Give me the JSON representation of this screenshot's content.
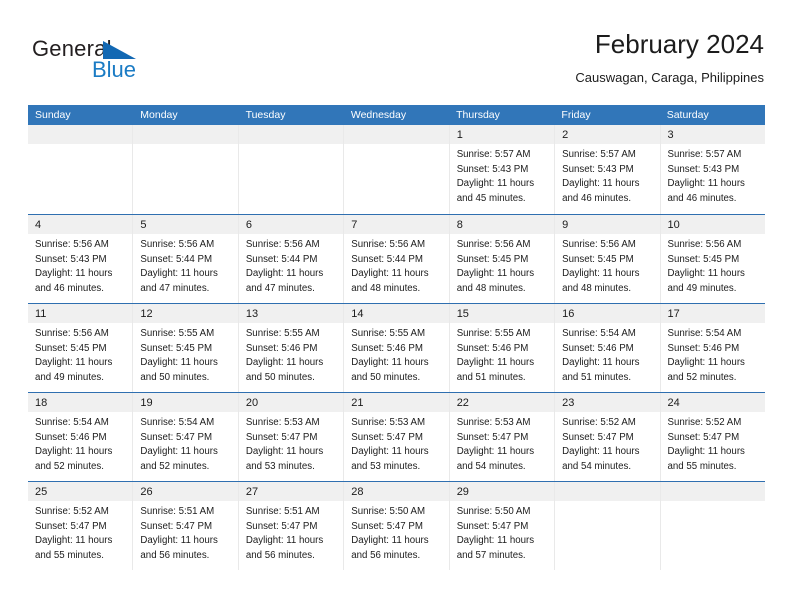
{
  "brand": {
    "name_top": "General",
    "name_bottom": "Blue"
  },
  "header": {
    "title": "February 2024",
    "subtitle": "Causwagan, Caraga, Philippines"
  },
  "colors": {
    "header_blue": "#3176b9",
    "row_divider_blue": "#2f6fb0",
    "day_head_gray": "#f0f0f0",
    "logo_blue": "#1a7bc4",
    "text": "#1c1c1c"
  },
  "weekdays": [
    "Sunday",
    "Monday",
    "Tuesday",
    "Wednesday",
    "Thursday",
    "Friday",
    "Saturday"
  ],
  "weeks": [
    [
      {
        "day": "",
        "empty": true,
        "lines": []
      },
      {
        "day": "",
        "empty": true,
        "lines": []
      },
      {
        "day": "",
        "empty": true,
        "lines": []
      },
      {
        "day": "",
        "empty": true,
        "lines": []
      },
      {
        "day": "1",
        "empty": false,
        "lines": [
          "Sunrise: 5:57 AM",
          "Sunset: 5:43 PM",
          "Daylight: 11 hours",
          "and 45 minutes."
        ]
      },
      {
        "day": "2",
        "empty": false,
        "lines": [
          "Sunrise: 5:57 AM",
          "Sunset: 5:43 PM",
          "Daylight: 11 hours",
          "and 46 minutes."
        ]
      },
      {
        "day": "3",
        "empty": false,
        "lines": [
          "Sunrise: 5:57 AM",
          "Sunset: 5:43 PM",
          "Daylight: 11 hours",
          "and 46 minutes."
        ]
      }
    ],
    [
      {
        "day": "4",
        "empty": false,
        "lines": [
          "Sunrise: 5:56 AM",
          "Sunset: 5:43 PM",
          "Daylight: 11 hours",
          "and 46 minutes."
        ]
      },
      {
        "day": "5",
        "empty": false,
        "lines": [
          "Sunrise: 5:56 AM",
          "Sunset: 5:44 PM",
          "Daylight: 11 hours",
          "and 47 minutes."
        ]
      },
      {
        "day": "6",
        "empty": false,
        "lines": [
          "Sunrise: 5:56 AM",
          "Sunset: 5:44 PM",
          "Daylight: 11 hours",
          "and 47 minutes."
        ]
      },
      {
        "day": "7",
        "empty": false,
        "lines": [
          "Sunrise: 5:56 AM",
          "Sunset: 5:44 PM",
          "Daylight: 11 hours",
          "and 48 minutes."
        ]
      },
      {
        "day": "8",
        "empty": false,
        "lines": [
          "Sunrise: 5:56 AM",
          "Sunset: 5:45 PM",
          "Daylight: 11 hours",
          "and 48 minutes."
        ]
      },
      {
        "day": "9",
        "empty": false,
        "lines": [
          "Sunrise: 5:56 AM",
          "Sunset: 5:45 PM",
          "Daylight: 11 hours",
          "and 48 minutes."
        ]
      },
      {
        "day": "10",
        "empty": false,
        "lines": [
          "Sunrise: 5:56 AM",
          "Sunset: 5:45 PM",
          "Daylight: 11 hours",
          "and 49 minutes."
        ]
      }
    ],
    [
      {
        "day": "11",
        "empty": false,
        "lines": [
          "Sunrise: 5:56 AM",
          "Sunset: 5:45 PM",
          "Daylight: 11 hours",
          "and 49 minutes."
        ]
      },
      {
        "day": "12",
        "empty": false,
        "lines": [
          "Sunrise: 5:55 AM",
          "Sunset: 5:45 PM",
          "Daylight: 11 hours",
          "and 50 minutes."
        ]
      },
      {
        "day": "13",
        "empty": false,
        "lines": [
          "Sunrise: 5:55 AM",
          "Sunset: 5:46 PM",
          "Daylight: 11 hours",
          "and 50 minutes."
        ]
      },
      {
        "day": "14",
        "empty": false,
        "lines": [
          "Sunrise: 5:55 AM",
          "Sunset: 5:46 PM",
          "Daylight: 11 hours",
          "and 50 minutes."
        ]
      },
      {
        "day": "15",
        "empty": false,
        "lines": [
          "Sunrise: 5:55 AM",
          "Sunset: 5:46 PM",
          "Daylight: 11 hours",
          "and 51 minutes."
        ]
      },
      {
        "day": "16",
        "empty": false,
        "lines": [
          "Sunrise: 5:54 AM",
          "Sunset: 5:46 PM",
          "Daylight: 11 hours",
          "and 51 minutes."
        ]
      },
      {
        "day": "17",
        "empty": false,
        "lines": [
          "Sunrise: 5:54 AM",
          "Sunset: 5:46 PM",
          "Daylight: 11 hours",
          "and 52 minutes."
        ]
      }
    ],
    [
      {
        "day": "18",
        "empty": false,
        "lines": [
          "Sunrise: 5:54 AM",
          "Sunset: 5:46 PM",
          "Daylight: 11 hours",
          "and 52 minutes."
        ]
      },
      {
        "day": "19",
        "empty": false,
        "lines": [
          "Sunrise: 5:54 AM",
          "Sunset: 5:47 PM",
          "Daylight: 11 hours",
          "and 52 minutes."
        ]
      },
      {
        "day": "20",
        "empty": false,
        "lines": [
          "Sunrise: 5:53 AM",
          "Sunset: 5:47 PM",
          "Daylight: 11 hours",
          "and 53 minutes."
        ]
      },
      {
        "day": "21",
        "empty": false,
        "lines": [
          "Sunrise: 5:53 AM",
          "Sunset: 5:47 PM",
          "Daylight: 11 hours",
          "and 53 minutes."
        ]
      },
      {
        "day": "22",
        "empty": false,
        "lines": [
          "Sunrise: 5:53 AM",
          "Sunset: 5:47 PM",
          "Daylight: 11 hours",
          "and 54 minutes."
        ]
      },
      {
        "day": "23",
        "empty": false,
        "lines": [
          "Sunrise: 5:52 AM",
          "Sunset: 5:47 PM",
          "Daylight: 11 hours",
          "and 54 minutes."
        ]
      },
      {
        "day": "24",
        "empty": false,
        "lines": [
          "Sunrise: 5:52 AM",
          "Sunset: 5:47 PM",
          "Daylight: 11 hours",
          "and 55 minutes."
        ]
      }
    ],
    [
      {
        "day": "25",
        "empty": false,
        "lines": [
          "Sunrise: 5:52 AM",
          "Sunset: 5:47 PM",
          "Daylight: 11 hours",
          "and 55 minutes."
        ]
      },
      {
        "day": "26",
        "empty": false,
        "lines": [
          "Sunrise: 5:51 AM",
          "Sunset: 5:47 PM",
          "Daylight: 11 hours",
          "and 56 minutes."
        ]
      },
      {
        "day": "27",
        "empty": false,
        "lines": [
          "Sunrise: 5:51 AM",
          "Sunset: 5:47 PM",
          "Daylight: 11 hours",
          "and 56 minutes."
        ]
      },
      {
        "day": "28",
        "empty": false,
        "lines": [
          "Sunrise: 5:50 AM",
          "Sunset: 5:47 PM",
          "Daylight: 11 hours",
          "and 56 minutes."
        ]
      },
      {
        "day": "29",
        "empty": false,
        "lines": [
          "Sunrise: 5:50 AM",
          "Sunset: 5:47 PM",
          "Daylight: 11 hours",
          "and 57 minutes."
        ]
      },
      {
        "day": "",
        "empty": true,
        "lines": []
      },
      {
        "day": "",
        "empty": true,
        "lines": []
      }
    ]
  ]
}
